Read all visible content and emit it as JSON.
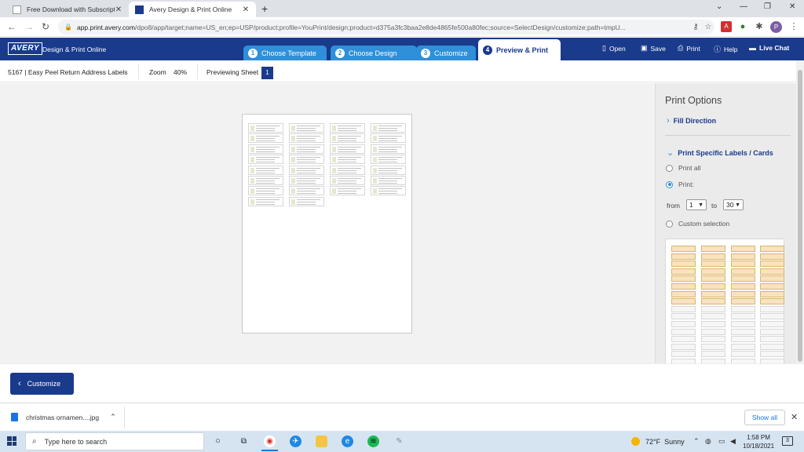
{
  "browser": {
    "tabs": [
      {
        "title": "Free Download with Subscription",
        "active": false
      },
      {
        "title": "Avery Design & Print Online",
        "active": true
      }
    ],
    "url_host": "app.print.avery.com",
    "url_path": "/dpo8/app/target;name=US_en;ep=USP/product;profile=YouPrint/design;product=d375a3fc3baa2e8de4865fe500a80fec;source=SelectDesign/customize;path=tmpU...",
    "profile_initial": "P"
  },
  "header": {
    "logo_text": "AVERY",
    "app_title": "Design & Print Online",
    "steps": [
      {
        "num": "1",
        "label": "Choose Template"
      },
      {
        "num": "2",
        "label": "Choose Design"
      },
      {
        "num": "3",
        "label": "Customize"
      },
      {
        "num": "4",
        "label": "Preview & Print"
      }
    ],
    "actions": {
      "open": "Open",
      "save": "Save",
      "print": "Print",
      "help": "Help",
      "live_chat": "Live Chat"
    }
  },
  "toolbar": {
    "product": "5167 | Easy Peel Return Address Labels",
    "zoom_label": "Zoom",
    "zoom_value": "40%",
    "previewing_label": "Previewing Sheet",
    "sheet_number": "1"
  },
  "print_options": {
    "title": "Print Options",
    "fill_direction": "Fill Direction",
    "specific_heading": "Print Specific Labels / Cards",
    "print_all": "Print all",
    "print_range": "Print:",
    "from_label": "from",
    "from_value": "1",
    "to_label": "to",
    "to_value": "30",
    "custom_selection": "Custom selection"
  },
  "footer": {
    "customize_button": "Customize"
  },
  "downloads": {
    "filename": "christmas ornamen....jpg",
    "show_all": "Show all"
  },
  "taskbar": {
    "search_placeholder": "Type here to search",
    "temperature": "72°F",
    "weather": "Sunny",
    "time": "1:58 PM",
    "date": "10/18/2021",
    "notifications": "3"
  },
  "label_sheet": {
    "columns": 4,
    "filled_rows": 8,
    "labels_on_sheet": 30
  },
  "mini_sheet": {
    "columns": 4,
    "rows": 20,
    "selected_rows": 8
  },
  "colors": {
    "avery_blue": "#1a3a8c",
    "step_blue": "#2f8fd8",
    "selected_label": "#f8e3bd"
  }
}
